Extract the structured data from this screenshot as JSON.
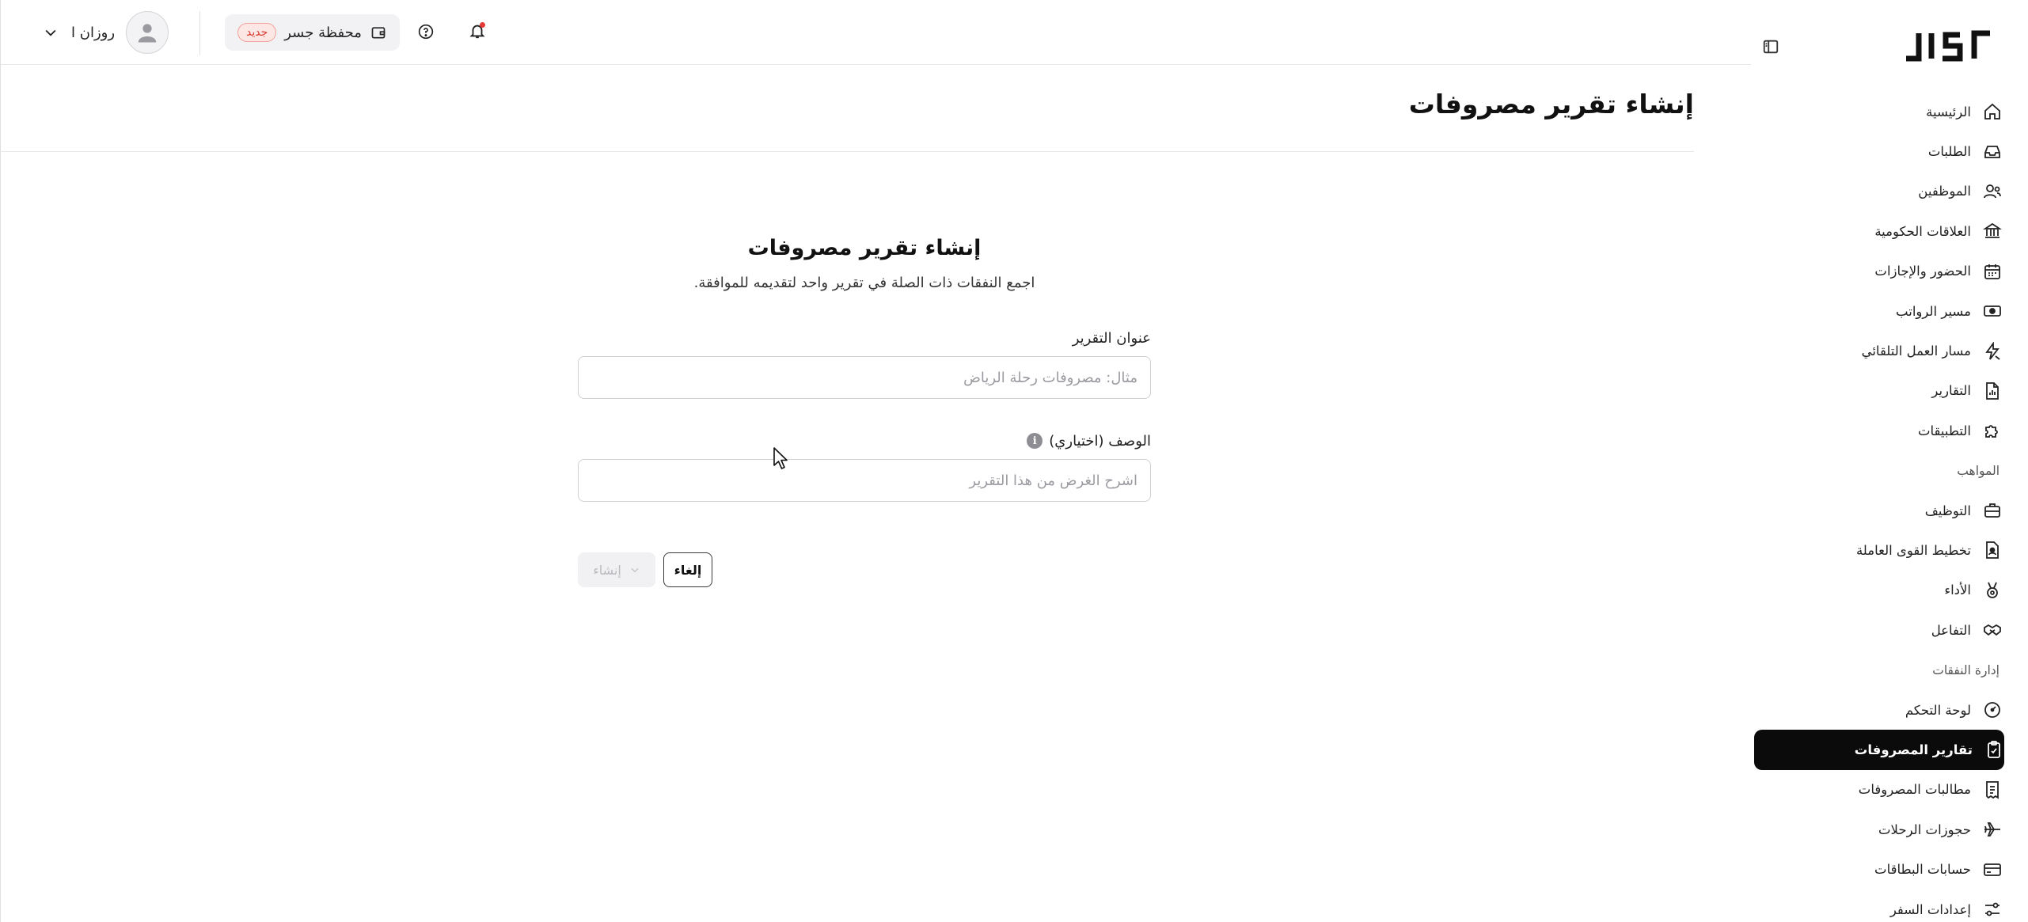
{
  "app": {
    "logo_text": "JISr"
  },
  "topbar": {
    "user_name": "روزان ا",
    "wallet_label": "محفظة جسر",
    "wallet_badge": "جديد"
  },
  "page": {
    "title": "إنشاء تقرير مصروفات"
  },
  "form": {
    "title": "إنشاء تقرير مصروفات",
    "subtitle": "اجمع النفقات ذات الصلة في تقرير واحد لتقديمه للموافقة.",
    "report_title_label": "عنوان التقرير",
    "report_title_placeholder": "مثال: مصروفات رحلة الرياض",
    "report_title_value": "",
    "description_label": "الوصف (اختياري)",
    "description_placeholder": "اشرح الغرض من هذا التقرير",
    "description_value": "",
    "create_label": "إنشاء",
    "cancel_label": "إلغاء"
  },
  "sidebar": {
    "items": [
      {
        "label": "الرئيسية",
        "icon": "home-icon"
      },
      {
        "label": "الطلبات",
        "icon": "inbox-icon"
      },
      {
        "label": "الموظفين",
        "icon": "users-icon"
      },
      {
        "label": "العلاقات الحكومية",
        "icon": "bank-icon"
      },
      {
        "label": "الحضور والإجازات",
        "icon": "calendar-icon"
      },
      {
        "label": "مسير الرواتب",
        "icon": "money-icon"
      },
      {
        "label": "مسار العمل التلقائي",
        "icon": "automation-icon"
      },
      {
        "label": "التقارير",
        "icon": "report-icon"
      },
      {
        "label": "التطبيقات",
        "icon": "puzzle-icon"
      }
    ],
    "section_talent": "المواهب",
    "talent_items": [
      {
        "label": "التوظيف",
        "icon": "briefcase-icon"
      },
      {
        "label": "تخطيط القوى العاملة",
        "icon": "workforce-icon"
      },
      {
        "label": "الأداء",
        "icon": "medal-icon"
      },
      {
        "label": "التفاعل",
        "icon": "handshake-icon"
      }
    ],
    "section_expenses": "إدارة النفقات",
    "expense_items": [
      {
        "label": "لوحة التحكم",
        "icon": "dashboard-icon"
      },
      {
        "label": "تقارير المصروفات",
        "icon": "clipboard-check-icon",
        "active": true
      },
      {
        "label": "مطالبات المصروفات",
        "icon": "receipt-icon"
      },
      {
        "label": "حجوزات الرحلات",
        "icon": "plane-icon"
      },
      {
        "label": "حسابات البطاقات",
        "icon": "card-icon"
      },
      {
        "label": "إعدادات السفر",
        "icon": "sliders-icon"
      }
    ]
  },
  "colors": {
    "active_bg": "#0b0b0c",
    "badge_text": "#d93a2f",
    "badge_bg": "#fde7e5"
  }
}
